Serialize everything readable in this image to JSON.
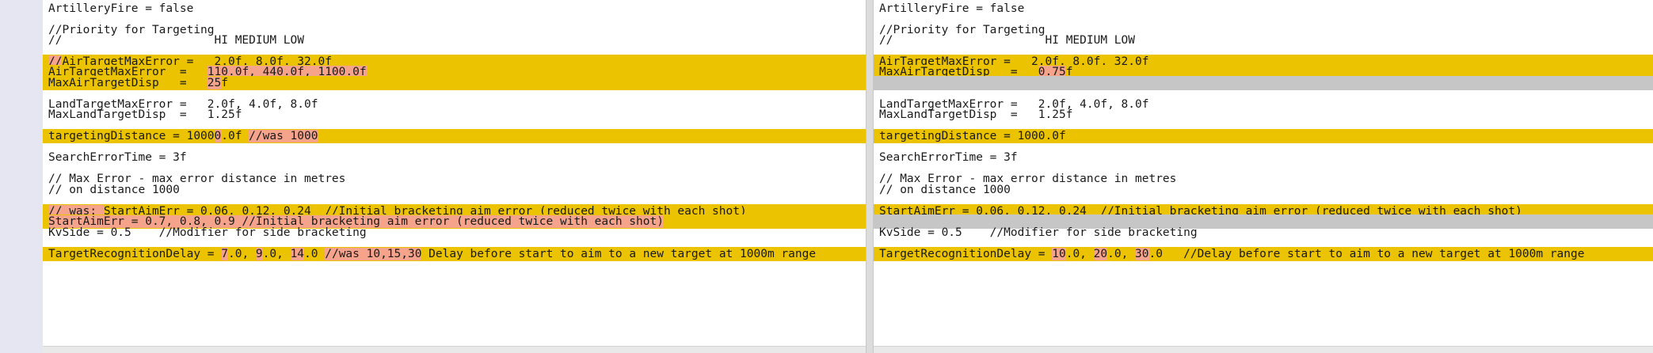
{
  "colors": {
    "changed_line": "#ecc300",
    "changed_segment": "#f6a38b",
    "placeholder_line": "#c6c6c6",
    "gutter": "#e6e6f2"
  },
  "left": {
    "lines": [
      [
        {
          "t": "ArtilleryFire = false"
        }
      ],
      [],
      [
        {
          "t": "//Priority for Targeting"
        }
      ],
      [
        {
          "t": "//                      HI MEDIUM LOW"
        }
      ],
      [],
      [
        {
          "t": "//",
          "h": true
        },
        {
          "t": "AirTargetMaxError =   2.0f, 8.0f, 32.0f"
        }
      ],
      [
        {
          "t": "AirTargetMaxError  =   "
        },
        {
          "t": "110.0f, 440.0f, 1100.0f",
          "h": true
        }
      ],
      [
        {
          "t": "MaxAirTargetDisp   =   "
        },
        {
          "t": "25",
          "h": true
        },
        {
          "t": "f"
        }
      ],
      [],
      [
        {
          "t": "LandTargetMaxError =   2.0f, 4.0f, 8.0f"
        }
      ],
      [
        {
          "t": "MaxLandTargetDisp  =   1.25f"
        }
      ],
      [],
      [
        {
          "t": "targetingDistance = 1000"
        },
        {
          "t": "0",
          "h": true
        },
        {
          "t": ".0f "
        },
        {
          "t": "//was 1000",
          "h": true
        }
      ],
      [],
      [
        {
          "t": "SearchErrorTime = 3f"
        }
      ],
      [],
      [
        {
          "t": "// Max Error - max error distance in metres"
        }
      ],
      [
        {
          "t": "// on distance 1000"
        }
      ],
      [],
      [
        {
          "t": "// was: ",
          "h": true
        },
        {
          "t": "StartAimErr = 0.06, 0.12, 0.24  //Initial bracketing aim error (reduced twice with each shot)"
        }
      ],
      [
        {
          "t": "StartAimErr = 0.7, 0.8, 0.9 //Initial bracketing aim error (reduced twice with each shot)",
          "h": true
        }
      ],
      [
        {
          "t": "KvSide = 0.5    //Modifier for side bracketing"
        }
      ],
      [],
      [
        {
          "t": "TargetRecognitionDelay = "
        },
        {
          "t": "7",
          "h": true
        },
        {
          "t": ".0, "
        },
        {
          "t": "9",
          "h": true
        },
        {
          "t": ".0, "
        },
        {
          "t": "14",
          "h": true
        },
        {
          "t": ".0 "
        },
        {
          "t": "//was 10,15,30",
          "h": true
        },
        {
          "t": " Delay before start to aim to a new target at 1000m range"
        }
      ]
    ]
  },
  "right": {
    "lines": [
      [
        {
          "t": "ArtilleryFire = false"
        }
      ],
      [],
      [
        {
          "t": "//Priority for Targeting"
        }
      ],
      [
        {
          "t": "//                      HI MEDIUM LOW"
        }
      ],
      [],
      [
        {
          "t": "AirTargetMaxError =   2.0f, 8.0f, 32.0f"
        }
      ],
      [
        {
          "t": "MaxAirTargetDisp   =   "
        },
        {
          "t": "0.75",
          "h": true
        },
        {
          "t": "f"
        }
      ],
      [],
      [],
      [
        {
          "t": "LandTargetMaxError =   2.0f, 4.0f, 8.0f"
        }
      ],
      [
        {
          "t": "MaxLandTargetDisp  =   1.25f"
        }
      ],
      [],
      [
        {
          "t": "targetingDistance = 1000.0f"
        }
      ],
      [],
      [
        {
          "t": "SearchErrorTime = 3f"
        }
      ],
      [],
      [
        {
          "t": "// Max Error - max error distance in metres"
        }
      ],
      [
        {
          "t": "// on distance 1000"
        }
      ],
      [],
      [
        {
          "t": "StartAimErr = 0.06, 0.12, 0.24  //Initial bracketing aim error (reduced twice with each shot)"
        }
      ],
      [],
      [
        {
          "t": "KvSide = 0.5    //Modifier for side bracketing"
        }
      ],
      [],
      [
        {
          "t": "TargetRecognitionDelay = "
        },
        {
          "t": "10",
          "h": true
        },
        {
          "t": ".0, "
        },
        {
          "t": "20",
          "h": true
        },
        {
          "t": ".0, "
        },
        {
          "t": "30",
          "h": true
        },
        {
          "t": ".0   //Delay before start to aim to a new target at 1000m range"
        }
      ]
    ]
  }
}
